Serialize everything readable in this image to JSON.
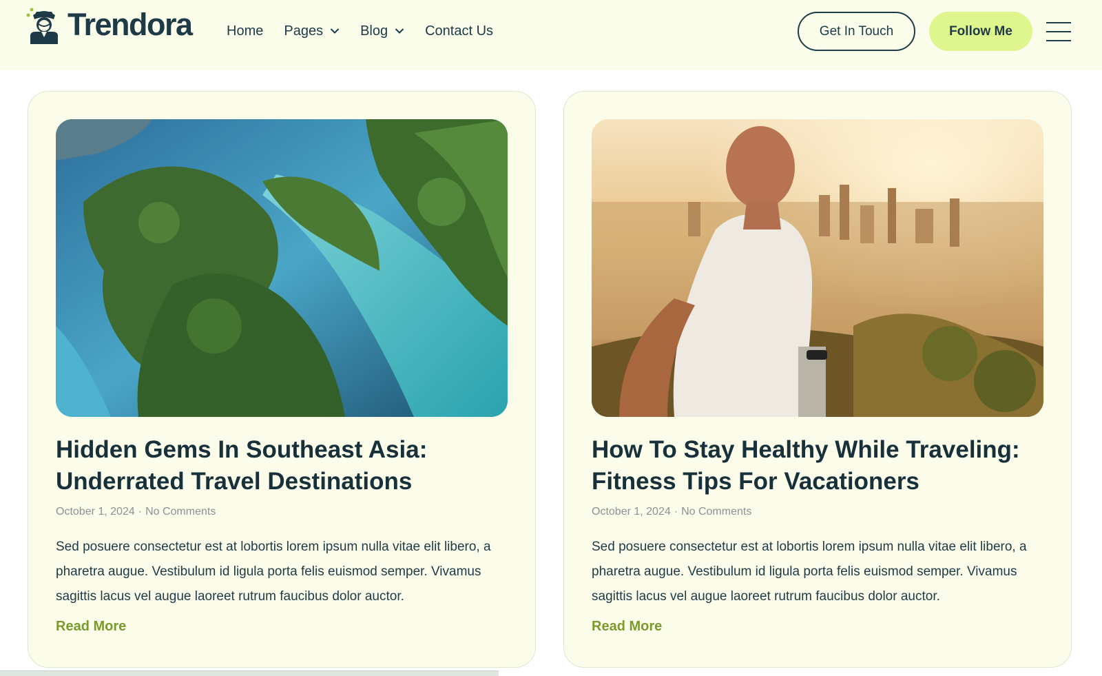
{
  "brand": {
    "name": "Trendora",
    "logo_icon": "traveler-avatar-icon"
  },
  "nav": {
    "items": [
      {
        "label": "Home",
        "has_dropdown": false
      },
      {
        "label": "Pages",
        "has_dropdown": true
      },
      {
        "label": "Blog",
        "has_dropdown": true
      },
      {
        "label": "Contact Us",
        "has_dropdown": false
      }
    ]
  },
  "header_actions": {
    "get_in_touch": "Get In Touch",
    "follow_me": "Follow Me",
    "menu_icon": "hamburger-menu-icon"
  },
  "colors": {
    "header_bg": "#f9fde9",
    "card_bg": "#fbfdea",
    "accent": "#dff58e",
    "read_more": "#7a9a2c",
    "text_dark": "#17303a"
  },
  "posts": [
    {
      "title": "Hidden Gems In Southeast Asia: Underrated Travel Destinations",
      "date": "October 1, 2024",
      "separator": "·",
      "comments": "No Comments",
      "excerpt": "Sed posuere consectetur est at lobortis lorem ipsum nulla vitae elit libero, a pharetra augue. Vestibulum id ligula porta felis euismod semper. Vivamus sagittis lacus vel augue laoreet rutrum faucibus dolor auctor.",
      "read_more": "Read More",
      "image": "aerial-tropical-islands-lagoon"
    },
    {
      "title": "How To Stay Healthy While Traveling: Fitness Tips For Vacationers",
      "date": "October 1, 2024",
      "separator": "·",
      "comments": "No Comments",
      "excerpt": "Sed posuere consectetur est at lobortis lorem ipsum nulla vitae elit libero, a pharetra augue. Vestibulum id ligula porta felis euismod semper. Vivamus sagittis lacus vel augue laoreet rutrum faucibus dolor auctor.",
      "read_more": "Read More",
      "image": "man-running-above-city-at-sunrise"
    }
  ]
}
